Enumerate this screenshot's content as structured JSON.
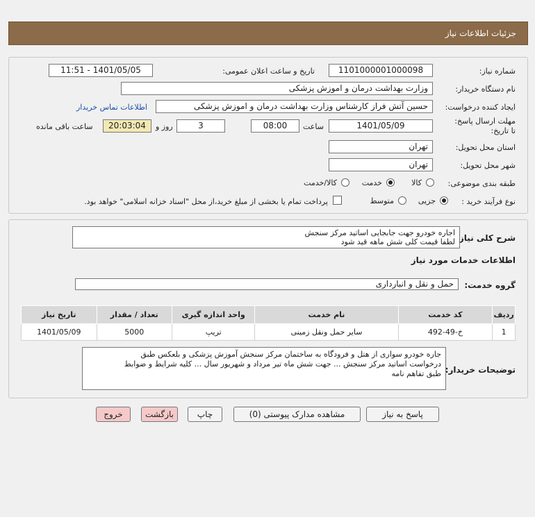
{
  "header": {
    "title": "جزئیات اطلاعات نیاز"
  },
  "fields": {
    "need_number_label": "شماره نیاز:",
    "need_number": "1101000001000098",
    "announce_label": "تاریخ و ساعت اعلان عمومی:",
    "announce_value": "1401/05/05 - 11:51",
    "buyer_org_label": "نام دستگاه خریدار:",
    "buyer_org": "وزارت بهداشت  درمان و اموزش پزشکی",
    "requester_label": "ایجاد کننده درخواست:",
    "requester": "حسین آتش فراز کارشناس وزارت بهداشت  درمان و اموزش پزشکی",
    "contact_link": "اطلاعات تماس خریدار",
    "deadline_label": "مهلت ارسال پاسخ: تا تاریخ:",
    "deadline_date": "1401/05/09",
    "time_label": "ساعت",
    "deadline_time": "08:00",
    "days_value": "3",
    "days_label": "روز و",
    "remaining_time": "20:03:04",
    "remaining_label": "ساعت باقی مانده",
    "province_label": "استان محل تحویل:",
    "province": "تهران",
    "city_label": "شهر محل تحویل:",
    "city": "تهران",
    "category_label": "طبقه بندی موضوعی:",
    "category_options": [
      "کالا",
      "خدمت",
      "کالا/خدمت"
    ],
    "process_label": "نوع فرآیند خرید :",
    "process_options": [
      "جزیی",
      "متوسط"
    ],
    "payment_note": "پرداخت تمام یا بخشی از مبلغ خرید،از محل \"اسناد خزانه اسلامی\" خواهد بود."
  },
  "general": {
    "desc_label": "شرح کلی نیاز:",
    "desc_line1": "اجاره خودرو جهت جابجایی اساتید مرکز سنجش",
    "desc_line2": "لطفا قیمت کلی شش ماهه قید شود",
    "services_title": "اطلاعات خدمات مورد نیاز",
    "group_label": "گروه خدمت:",
    "group_value": "حمل و نقل و انبارداری"
  },
  "table": {
    "headers": [
      "ردیف",
      "کد خدمت",
      "نام خدمت",
      "واحد اندازه گیری",
      "تعداد / مقدار",
      "تاریخ نیاز"
    ],
    "rows": [
      [
        "1",
        "خ-49-492",
        "سایر حمل ونقل زمینی",
        "تریپ",
        "5000",
        "1401/05/09"
      ]
    ]
  },
  "notes": {
    "label": "توضیحات خریدار:",
    "line1": "جاره خودرو سواری از هتل و فرودگاه به ساختمان مرکز سنجش آموزش پزشکی و بلعکس  طبق",
    "line2": "درخواست اساتید مرکز سنجش ... جهت شش ماه تیر مرداد و شهریور سال ... کلیه شرایط و ضوابط",
    "line3": "طبق تفاهم نامه"
  },
  "buttons": {
    "reply": "پاسخ به نیاز",
    "attachments": "مشاهده مدارک پیوستی (0)",
    "print": "چاپ",
    "back": "بازگشت",
    "exit": "خروج"
  },
  "colors": {
    "header": "#8b6b49",
    "pink_button": "#f6c9c9",
    "remaining_box": "#f2e8b3"
  }
}
